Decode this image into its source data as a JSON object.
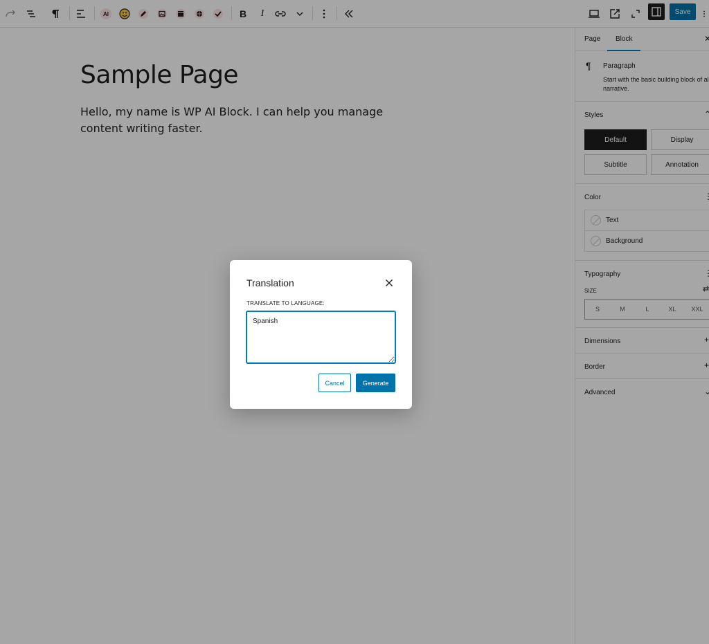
{
  "toolbar": {
    "save_label": "Save",
    "buttons": [
      "redo-icon",
      "list-view-icon",
      "paragraph-icon",
      "align-icon",
      "ai-icon",
      "emoji-icon",
      "pencil-icon",
      "image-icon",
      "archive-icon",
      "globe-icon",
      "check-icon",
      "bold-icon",
      "italic-icon",
      "link-icon",
      "chevron-down-icon",
      "more-vertical-icon",
      "collapse-icon"
    ],
    "ai_label": "AI",
    "bold_label": "B",
    "italic_label": "I"
  },
  "editor": {
    "title": "Sample Page",
    "paragraph": "Hello, my name is WP AI Block. I can help you manage content writing faster."
  },
  "sidebar": {
    "tabs": [
      "Page",
      "Block"
    ],
    "block": {
      "name": "Paragraph",
      "description": "Start with the basic building block of all narrative."
    },
    "styles": {
      "title": "Styles",
      "options": [
        "Default",
        "Display",
        "Subtitle",
        "Annotation"
      ],
      "active": "Default"
    },
    "color": {
      "title": "Color",
      "items": [
        "Text",
        "Background"
      ]
    },
    "typography": {
      "title": "Typography",
      "size_label": "SIZE",
      "sizes": [
        "S",
        "M",
        "L",
        "XL",
        "XXL"
      ]
    },
    "dimensions": "Dimensions",
    "border": "Border",
    "advanced": "Advanced"
  },
  "modal": {
    "title": "Translation",
    "label": "TRANSLATE TO LANGUAGE:",
    "value": "Spanish",
    "cancel_label": "Cancel",
    "generate_label": "Generate"
  },
  "colors": {
    "accent": "#0073aa",
    "overlay": "rgba(0,0,0,0.35)"
  }
}
